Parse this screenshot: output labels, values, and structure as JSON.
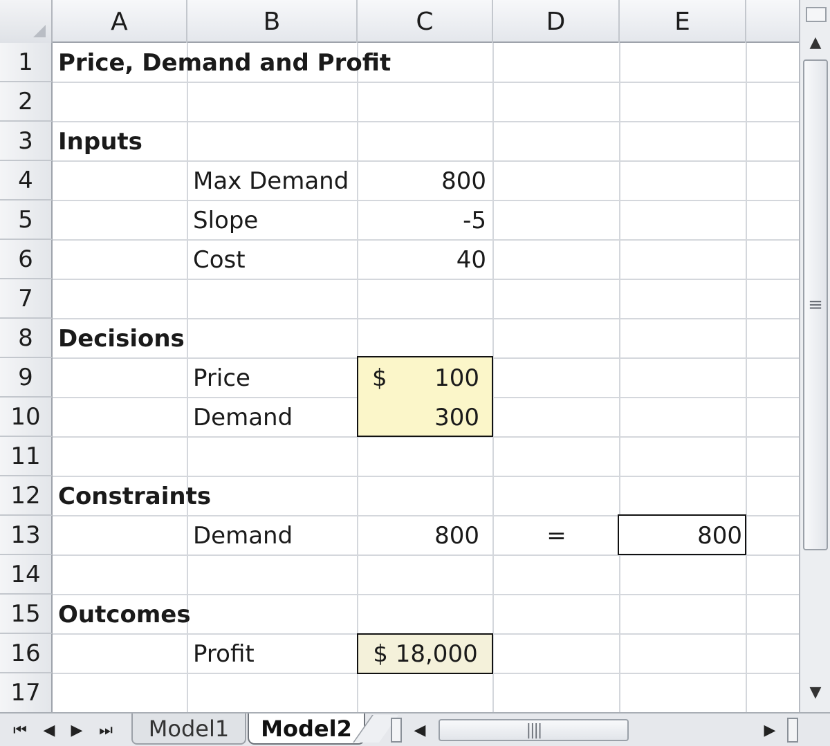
{
  "columns": [
    "A",
    "B",
    "C",
    "D",
    "E"
  ],
  "rows": [
    "1",
    "2",
    "3",
    "4",
    "5",
    "6",
    "7",
    "8",
    "9",
    "10",
    "11",
    "12",
    "13",
    "14",
    "15",
    "16",
    "17"
  ],
  "cells": {
    "A1": "Price, Demand and Profit",
    "A3": "Inputs",
    "B4": "Max Demand",
    "C4": "800",
    "B5": "Slope",
    "C5": "-5",
    "B6": "Cost",
    "C6": "40",
    "A8": "Decisions",
    "B9": "Price",
    "C9_currency": "$",
    "C9_value": "100",
    "B10": "Demand",
    "C10": "300",
    "A12": "Constraints",
    "B13": "Demand",
    "C13": "800",
    "D13": "=",
    "E13": "800",
    "A15": "Outcomes",
    "B16": "Profit",
    "C16": "$ 18,000"
  },
  "sheet_tabs": [
    {
      "label": "Model1",
      "active": false
    },
    {
      "label": "Model2",
      "active": true
    }
  ],
  "colors": {
    "decision_fill": "#fbf6c9",
    "outcome_fill": "#f4f1da",
    "border": "#111111"
  }
}
